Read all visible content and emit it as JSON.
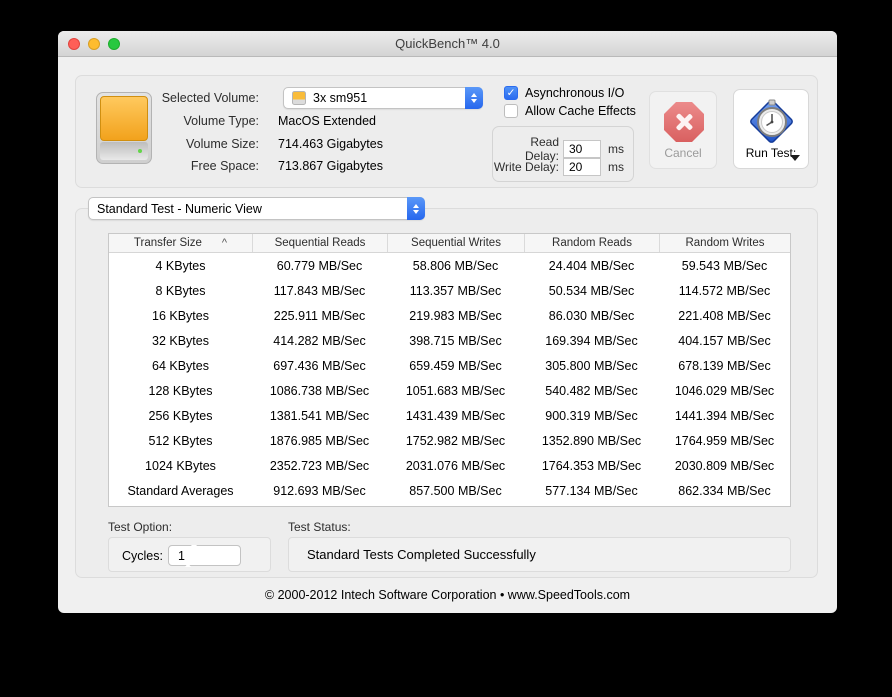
{
  "window": {
    "title": "QuickBench™ 4.0"
  },
  "volume_panel": {
    "selected_volume_label": "Selected Volume:",
    "selected_volume_value": "3x sm951",
    "volume_type_label": "Volume Type:",
    "volume_type_value": "MacOS Extended",
    "volume_size_label": "Volume Size:",
    "volume_size_value": "714.463 Gigabytes",
    "free_space_label": "Free Space:",
    "free_space_value": "713.867 Gigabytes"
  },
  "options": {
    "async_io": {
      "label": "Asynchronous I/O",
      "checked": true
    },
    "cache_effects": {
      "label": "Allow Cache Effects",
      "checked": false
    },
    "read_delay_label": "Read Delay:",
    "read_delay_value": "30",
    "write_delay_label": "Write Delay:",
    "write_delay_value": "20",
    "ms_unit": "ms"
  },
  "actions": {
    "cancel_label": "Cancel",
    "run_test_label": "Run Test:"
  },
  "view_selector": {
    "value": "Standard Test - Numeric View"
  },
  "results_table": {
    "columns": [
      "Transfer Size",
      "Sequential Reads",
      "Sequential Writes",
      "Random Reads",
      "Random Writes"
    ],
    "sort_indicator": "^",
    "rows": [
      [
        "4 KBytes",
        "60.779 MB/Sec",
        "58.806 MB/Sec",
        "24.404 MB/Sec",
        "59.543 MB/Sec"
      ],
      [
        "8 KBytes",
        "117.843 MB/Sec",
        "113.357 MB/Sec",
        "50.534 MB/Sec",
        "114.572 MB/Sec"
      ],
      [
        "16 KBytes",
        "225.911 MB/Sec",
        "219.983 MB/Sec",
        "86.030 MB/Sec",
        "221.408 MB/Sec"
      ],
      [
        "32 KBytes",
        "414.282 MB/Sec",
        "398.715 MB/Sec",
        "169.394 MB/Sec",
        "404.157 MB/Sec"
      ],
      [
        "64 KBytes",
        "697.436 MB/Sec",
        "659.459 MB/Sec",
        "305.800 MB/Sec",
        "678.139 MB/Sec"
      ],
      [
        "128 KBytes",
        "1086.738 MB/Sec",
        "1051.683 MB/Sec",
        "540.482 MB/Sec",
        "1046.029 MB/Sec"
      ],
      [
        "256 KBytes",
        "1381.541 MB/Sec",
        "1431.439 MB/Sec",
        "900.319 MB/Sec",
        "1441.394 MB/Sec"
      ],
      [
        "512 KBytes",
        "1876.985 MB/Sec",
        "1752.982 MB/Sec",
        "1352.890 MB/Sec",
        "1764.959 MB/Sec"
      ],
      [
        "1024 KBytes",
        "2352.723 MB/Sec",
        "2031.076 MB/Sec",
        "1764.353 MB/Sec",
        "2030.809 MB/Sec"
      ],
      [
        "Standard Averages",
        "912.693 MB/Sec",
        "857.500 MB/Sec",
        "577.134 MB/Sec",
        "862.334 MB/Sec"
      ]
    ]
  },
  "test_option": {
    "section_label": "Test Option:",
    "cycles_label": "Cycles:",
    "cycles_value": "1"
  },
  "test_status": {
    "section_label": "Test Status:",
    "message": "Standard Tests Completed Successfully"
  },
  "footer": {
    "copyright": "© 2000-2012 Intech Software Corporation • www.SpeedTools.com"
  },
  "colors": {
    "accent_blue": "#2a6bef",
    "cancel_red": "#d96060",
    "drive_orange": "#f2a21c",
    "traffic_red": "#ff5f57",
    "traffic_yellow": "#febc2e",
    "traffic_green": "#28c840"
  }
}
